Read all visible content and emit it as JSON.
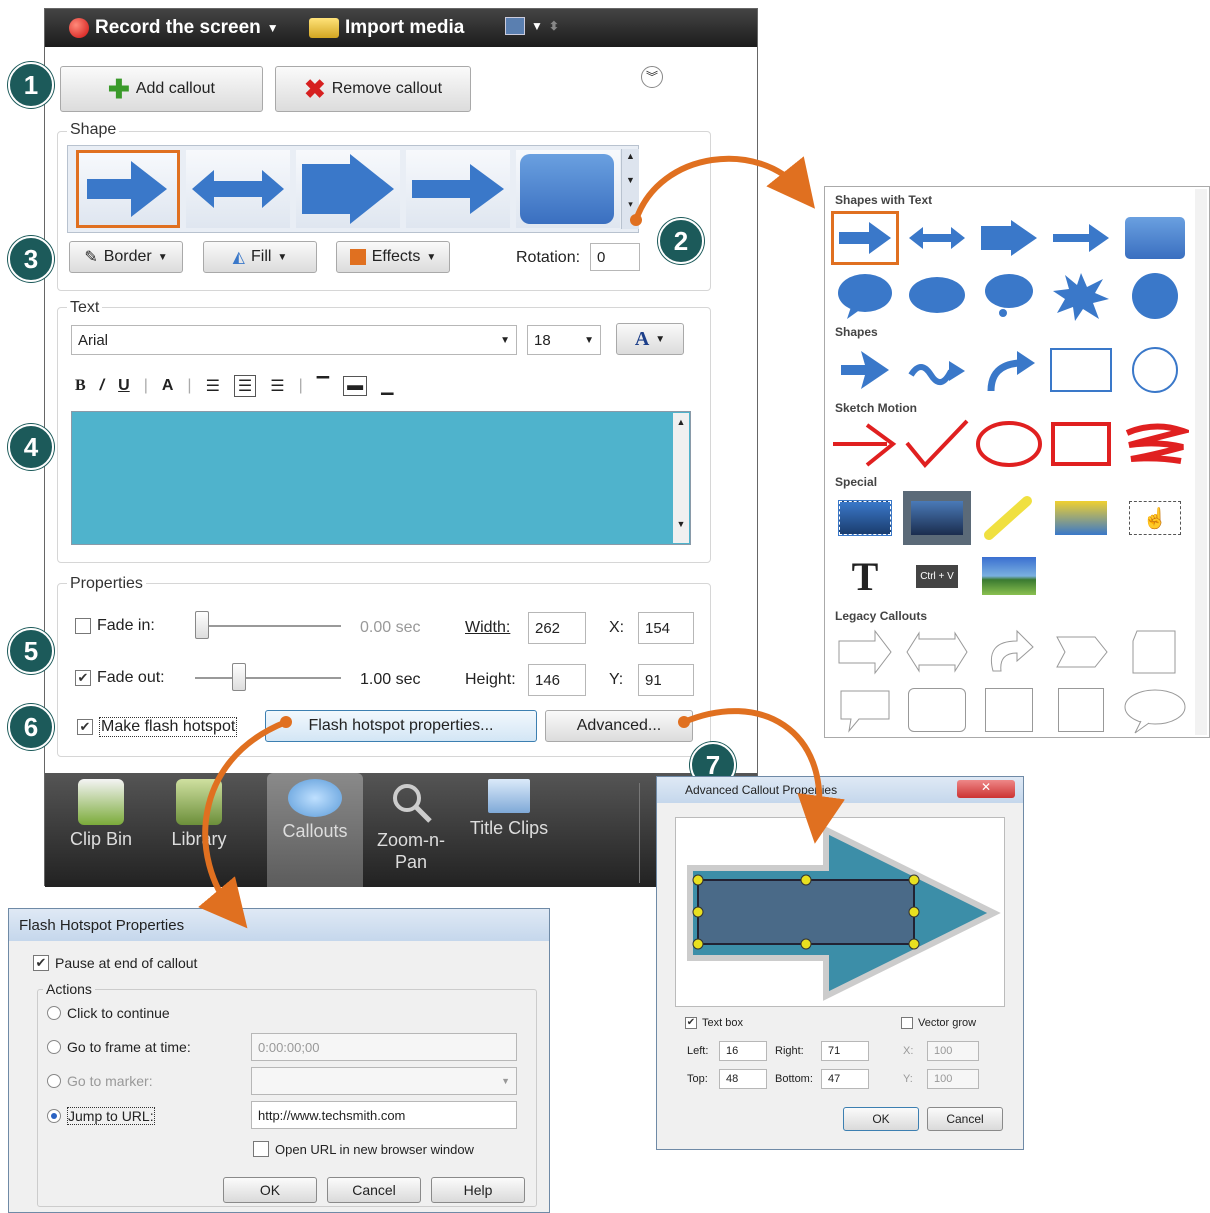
{
  "topbar": {
    "record": "Record the screen",
    "import": "Import media"
  },
  "callout_buttons": {
    "add": "Add callout",
    "remove": "Remove callout"
  },
  "shape": {
    "legend": "Shape",
    "border": "Border",
    "fill": "Fill",
    "effects": "Effects",
    "rotation_label": "Rotation:",
    "rotation_value": "0"
  },
  "text": {
    "legend": "Text",
    "font": "Arial",
    "size": "18",
    "color_btn": "A"
  },
  "properties": {
    "legend": "Properties",
    "fade_in": "Fade in:",
    "fade_in_value": "0.00 sec",
    "fade_out": "Fade out:",
    "fade_out_value": "1.00 sec",
    "width_label": "Width:",
    "width_value": "262",
    "height_label": "Height:",
    "height_value": "146",
    "x_label": "X:",
    "x_value": "154",
    "y_label": "Y:",
    "y_value": "91",
    "fade_in_level": 0.0,
    "fade_out_level": 0.25,
    "hotspot_label": "Make flash hotspot",
    "hotspot_props": "Flash hotspot properties...",
    "advanced": "Advanced..."
  },
  "tabs": [
    {
      "label": "Clip Bin"
    },
    {
      "label": "Library"
    },
    {
      "label": "Callouts"
    },
    {
      "label": "Zoom-n-Pan"
    },
    {
      "label": "Title Clips"
    }
  ],
  "numbers": [
    "1",
    "2",
    "3",
    "4",
    "5",
    "6",
    "7"
  ],
  "gallery": {
    "shapes_with_text": "Shapes with Text",
    "shapes": "Shapes",
    "sketch_motion": "Sketch Motion",
    "special": "Special",
    "legacy": "Legacy Callouts",
    "special_t": "T",
    "special_ctrl": "Ctrl + V"
  },
  "hotspot_dialog": {
    "title": "Flash Hotspot Properties",
    "pause": "Pause at end of callout",
    "actions": "Actions",
    "click": "Click to continue",
    "goto_frame": "Go to frame at time:",
    "frame_value": "0:00:00;00",
    "goto_marker": "Go to marker:",
    "jump_url": "Jump to URL:",
    "url_value": "http://www.techsmith.com",
    "open_new": "Open URL in new browser window",
    "ok": "OK",
    "cancel": "Cancel",
    "help": "Help"
  },
  "advanced_dialog": {
    "title": "Advanced Callout Properties",
    "text_box": "Text box",
    "vector_grow": "Vector grow",
    "left_label": "Left:",
    "left_value": "16",
    "right_label": "Right:",
    "right_value": "71",
    "top_label": "Top:",
    "top_value": "48",
    "bottom_label": "Bottom:",
    "bottom_value": "47",
    "x_label": "X:",
    "x_value": "100",
    "y_label": "Y:",
    "y_value": "100",
    "ok": "OK",
    "cancel": "Cancel"
  },
  "colors": {
    "accent_orange": "#e07020",
    "teal_number": "#1c5a5a",
    "text_area": "#4fb3cc",
    "arrow_blue": "#3a78c9"
  }
}
